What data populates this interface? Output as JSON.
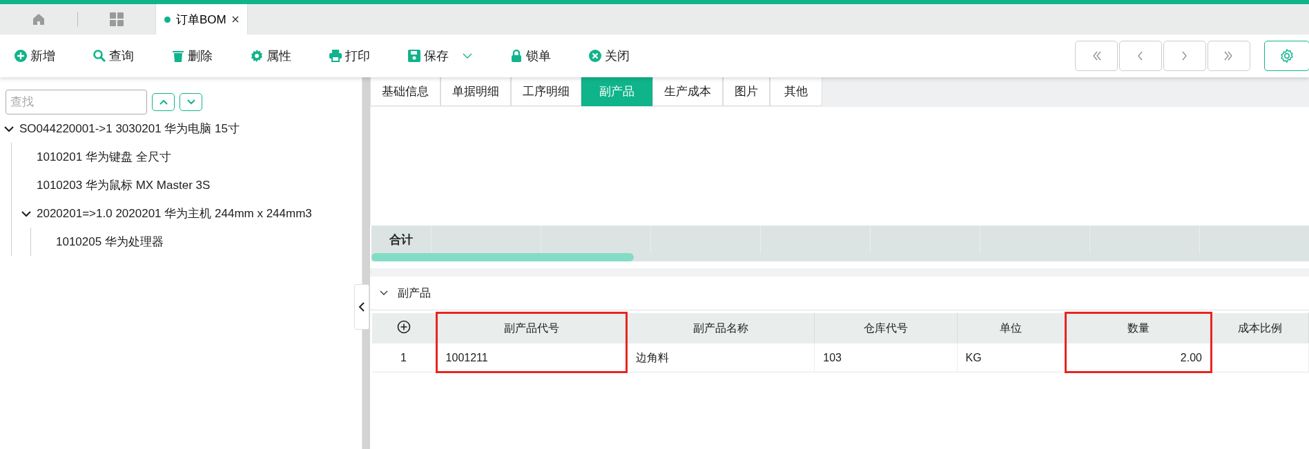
{
  "top_tabs": [
    {
      "kind": "home",
      "selected": false
    },
    {
      "kind": "apps",
      "selected": false
    },
    {
      "kind": "doc",
      "label": "订单BOM",
      "selected": true
    }
  ],
  "toolbar": [
    {
      "kind": "plus",
      "label": "新增"
    },
    {
      "kind": "search",
      "label": "查询"
    },
    {
      "kind": "trash",
      "label": "删除"
    },
    {
      "kind": "gear",
      "label": "属性"
    },
    {
      "kind": "printer",
      "label": "打印"
    },
    {
      "kind": "disk",
      "label": "保存",
      "dropdown": true
    },
    {
      "kind": "lock",
      "label": "锁单"
    },
    {
      "kind": "close",
      "label": "关闭"
    }
  ],
  "pager": [
    {
      "kind": "first"
    },
    {
      "kind": "prev"
    },
    {
      "kind": "next"
    },
    {
      "kind": "last"
    }
  ],
  "sidebar": {
    "search": {
      "placeholder": "查找"
    },
    "tree": [
      {
        "label": "SO044220001->1 3030201 华为电脑 15寸",
        "expanded": true,
        "children": [
          {
            "label": "1010201 华为键盘 全尺寸"
          },
          {
            "label": "1010203 华为鼠标 MX Master 3S"
          },
          {
            "label": "2020201=>1.0 2020201 华为主机 244mm x 244mm3",
            "expanded": true,
            "children": [
              {
                "label": "1010205 华为处理器"
              }
            ]
          }
        ]
      }
    ]
  },
  "tabs": [
    {
      "label": "基础信息",
      "selected": false
    },
    {
      "label": "单据明细",
      "selected": false
    },
    {
      "label": "工序明细",
      "selected": false
    },
    {
      "label": "副产品",
      "selected": true
    },
    {
      "label": "生产成本",
      "selected": false
    },
    {
      "label": "图片",
      "selected": false
    },
    {
      "label": "其他",
      "selected": false
    }
  ],
  "summary_row": {
    "label": "合计"
  },
  "section": {
    "title": "副产品",
    "expanded": true
  },
  "table": {
    "columns": [
      {
        "label": "副产品代号",
        "highlighted": true
      },
      {
        "label": "副产品名称",
        "highlighted": false
      },
      {
        "label": "仓库代号",
        "highlighted": false
      },
      {
        "label": "单位",
        "highlighted": false
      },
      {
        "label": "数量",
        "highlighted": true
      },
      {
        "label": "成本比例",
        "highlighted": false
      }
    ],
    "rows": [
      {
        "index": "1",
        "cells": [
          "1001211",
          "边角料",
          "103",
          "KG",
          "2.00",
          ""
        ]
      }
    ]
  }
}
